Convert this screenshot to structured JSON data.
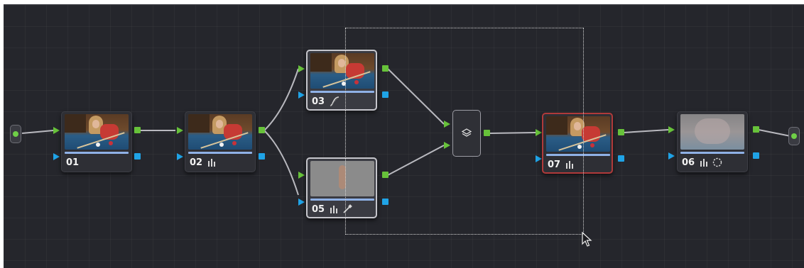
{
  "colors": {
    "canvas_bg": "#25262c",
    "wire": "#b9b9bf",
    "rgb_port": "#67c23a",
    "key_port": "#1fa3e6",
    "active_node_border": "#b03a3a",
    "selected_node_border": "#c6c6cc"
  },
  "nodes": [
    {
      "id": "01",
      "label": "01",
      "tools": []
    },
    {
      "id": "02",
      "label": "02",
      "tools": [
        "bars-icon"
      ]
    },
    {
      "id": "03",
      "label": "03",
      "tools": [
        "curve-icon"
      ]
    },
    {
      "id": "05",
      "label": "05",
      "tools": [
        "bars-icon",
        "eyedropper-icon"
      ]
    },
    {
      "id": "07",
      "label": "07",
      "tools": [
        "bars-icon"
      ]
    },
    {
      "id": "06",
      "label": "06",
      "tools": [
        "bars-icon",
        "circle-window-icon"
      ]
    }
  ],
  "layer_mixer": {
    "icon": "layers-icon"
  },
  "source_icon": "source-dot-icon",
  "output_icon": "output-dot-icon",
  "cursor_icon": "arrow-cursor-icon"
}
